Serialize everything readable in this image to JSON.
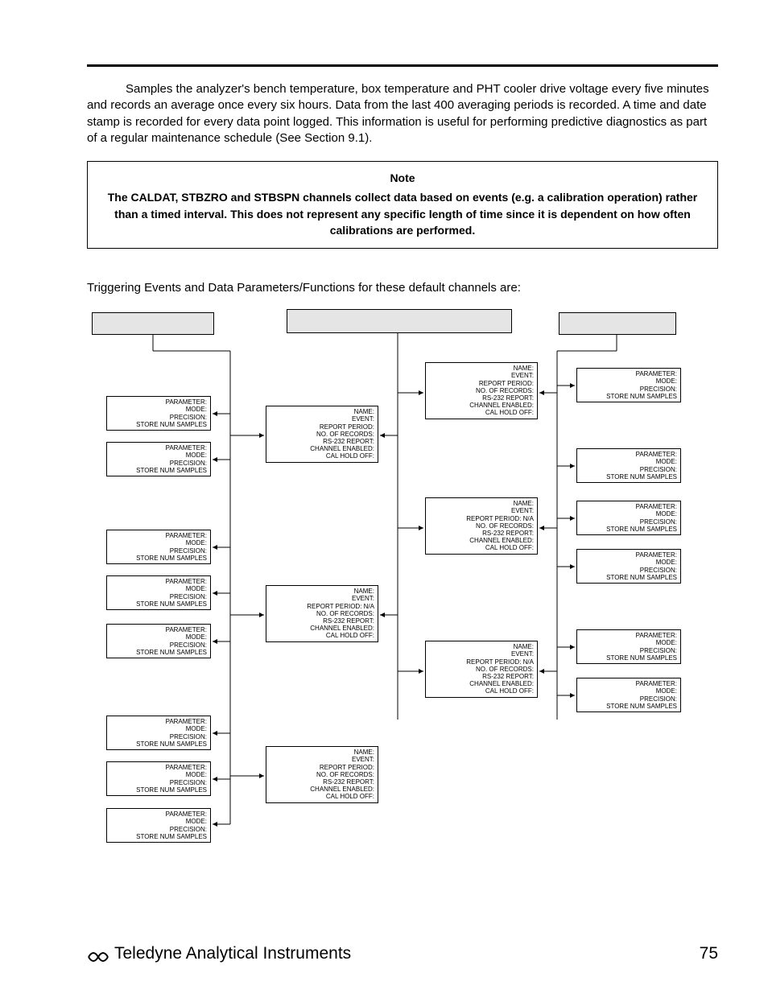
{
  "paragraph": "Samples the analyzer's bench temperature, box temperature and PHT cooler drive voltage every five minutes and records an average once every six hours.  Data from the last 400 averaging periods is recorded.  A time and date stamp is recorded for every data point logged.  This information is useful for performing predictive diagnostics as part of a regular maintenance schedule (See Section 9.1).",
  "note": {
    "title": "Note",
    "body": "The CALDAT, STBZRO and STBSPN channels collect data based on events (e.g.  a calibration operation) rather than a timed interval.  This does not represent any specific length of time since it is dependent on how often calibrations are performed."
  },
  "trigger_intro": "Triggering Events and Data Parameters/Functions for these default channels are:",
  "diagram": {
    "headers": [
      "",
      "",
      ""
    ],
    "param_fields": [
      "PARAMETER:",
      "MODE:",
      "PRECISION:",
      "STORE NUM SAMPLES"
    ],
    "channel_fields_full": [
      "NAME:",
      "EVENT:",
      "REPORT PERIOD:",
      "NO. OF RECORDS:",
      "RS-232 REPORT:",
      "CHANNEL ENABLED:",
      "CAL HOLD OFF:"
    ],
    "channel_fields_na": [
      "NAME:",
      "EVENT:",
      "REPORT PERIOD: N/A",
      "NO. OF RECORDS:",
      "RS-232 REPORT:",
      "CHANNEL ENABLED:",
      "CAL HOLD OFF:"
    ]
  },
  "footer": {
    "company": "Teledyne Analytical Instruments",
    "page": "75"
  }
}
